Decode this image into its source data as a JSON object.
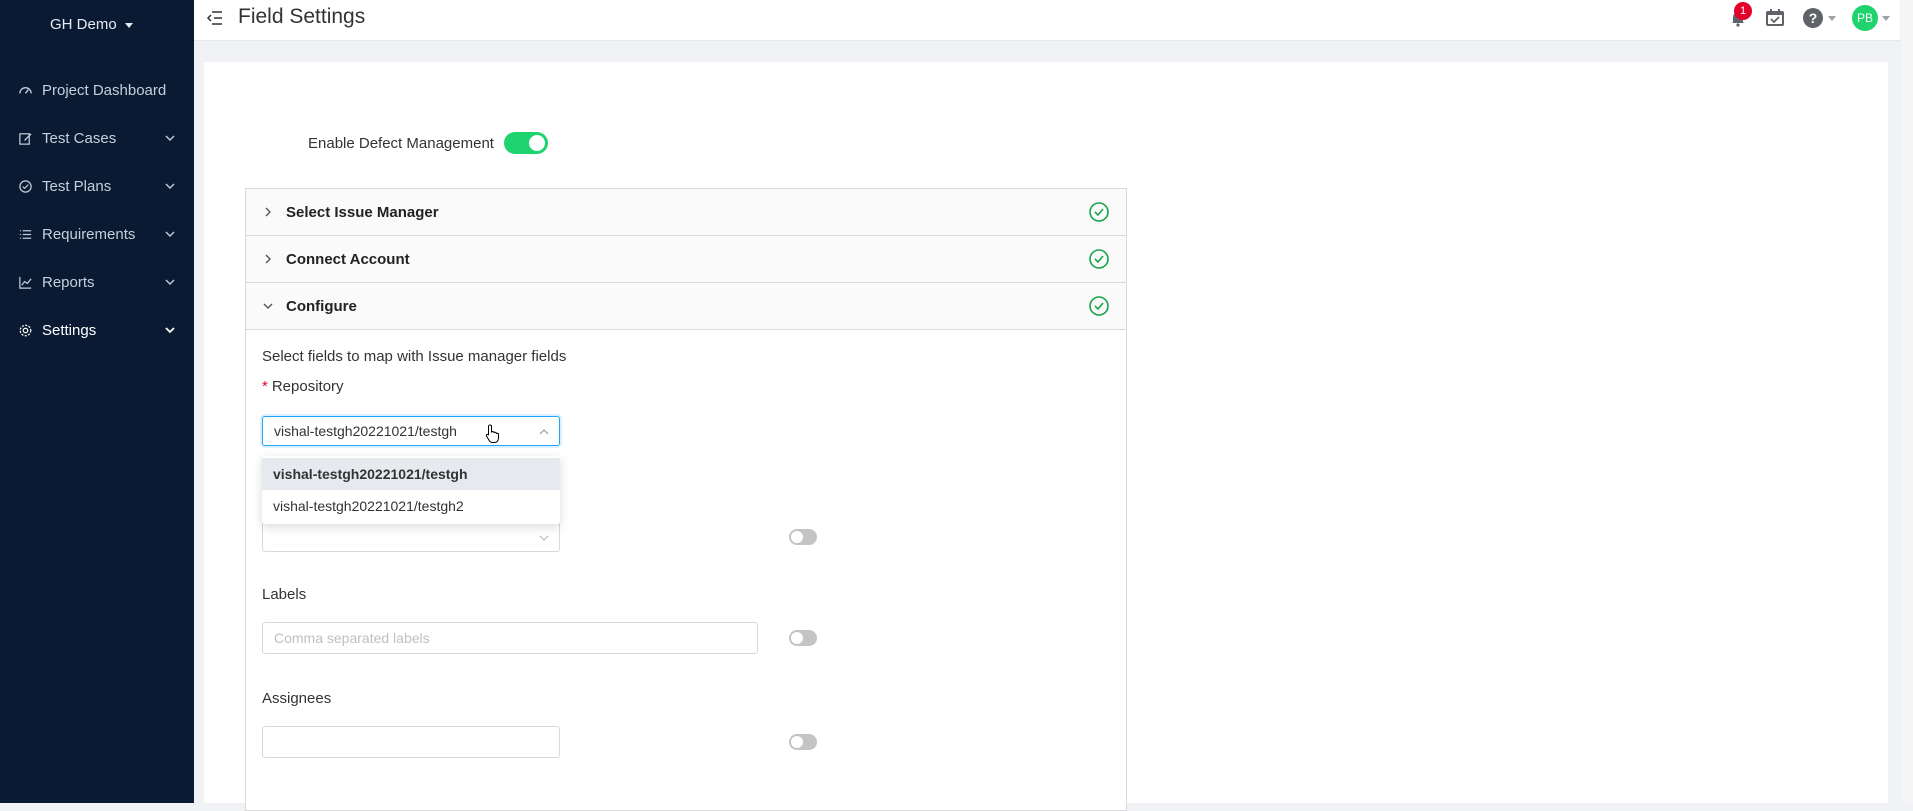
{
  "workspace": {
    "name": "GH Demo"
  },
  "sidebar": {
    "items": [
      {
        "label": "Project Dashboard"
      },
      {
        "label": "Test Cases"
      },
      {
        "label": "Test Plans"
      },
      {
        "label": "Requirements"
      },
      {
        "label": "Reports"
      },
      {
        "label": "Settings"
      }
    ]
  },
  "header": {
    "title": "Field Settings",
    "notification_count": "1",
    "avatar_initials": "PB"
  },
  "main": {
    "enable_defect_label": "Enable Defect Management",
    "panels": [
      {
        "title": "Select Issue Manager"
      },
      {
        "title": "Connect Account"
      },
      {
        "title": "Configure"
      }
    ],
    "configure": {
      "hint": "Select fields to map with Issue manager fields",
      "repository_label": "Repository",
      "repository_value": "vishal-testgh20221021/testgh",
      "repository_options": [
        "vishal-testgh20221021/testgh",
        "vishal-testgh20221021/testgh2"
      ],
      "labels_label": "Labels",
      "labels_placeholder": "Comma separated labels",
      "assignees_label": "Assignees"
    }
  },
  "colors": {
    "sidebar_bg": "#0b1a33",
    "accent_green": "#1fd36f",
    "focus_blue": "#1ea7fd",
    "badge_red": "#e4002b"
  }
}
